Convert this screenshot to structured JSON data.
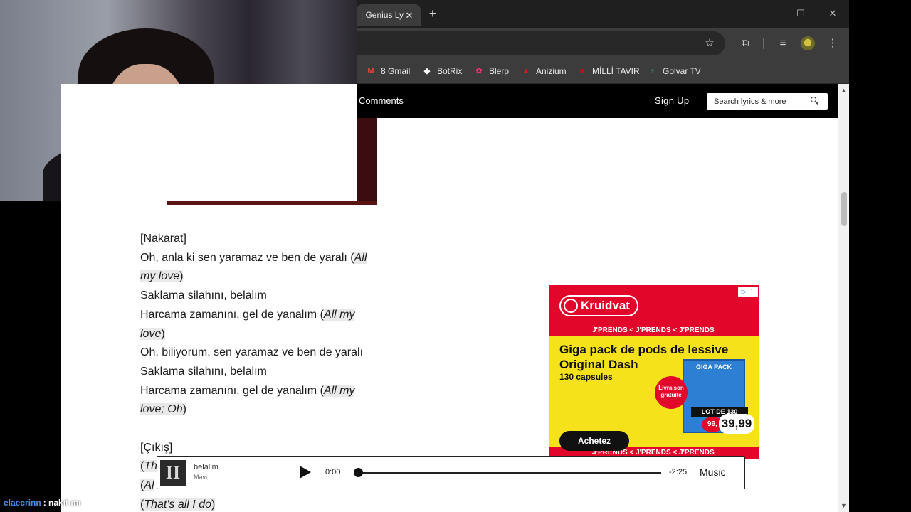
{
  "browser": {
    "tab_title": "| Genius Ly",
    "tab_close": "✕",
    "new_tab": "+",
    "window_minimize": "—",
    "window_maximize": "☐",
    "window_close": "✕",
    "toolbar_icons": [
      "star-icon",
      "extensions-icon",
      "media-controls-icon",
      "profile-avatar-icon",
      "menu-kebab-icon"
    ],
    "bookmarks": [
      {
        "label": "8 Gmail",
        "icon": "gmail-icon",
        "color": "#ea4335"
      },
      {
        "label": "BotRix",
        "icon": "botrix-icon",
        "color": "#ffffff"
      },
      {
        "label": "Blerp",
        "icon": "blerp-icon",
        "color": "#e8356b"
      },
      {
        "label": "Anizium",
        "icon": "anizium-icon",
        "color": "#d42020"
      },
      {
        "label": "MİLLİ TAVIR",
        "icon": "milli-tavir-icon",
        "color": "#b3121b"
      },
      {
        "label": "Golvar TV",
        "icon": "golvar-tv-icon",
        "color": "#2fbf71"
      }
    ]
  },
  "genius": {
    "nav_comments": "Comments",
    "nav_signup": "Sign Up",
    "search_placeholder": "Search lyrics & more"
  },
  "lyrics": {
    "nakarat_header": "[Nakarat]",
    "l1a": "Oh, anla ki sen yaramaz ve ben de yaralı (",
    "l1b": "All",
    "l2a": "my love",
    "l2b": ")",
    "l3": "Saklama silahını, belalım",
    "l4a": "Harcama zamanını, gel de yanalım (",
    "l4b": "All my",
    "l5a": "love",
    "l5b": ")",
    "l6": "Oh, biliyorum, sen yaramaz ve ben de yaralı",
    "l7": "Saklama silahını, belalım",
    "l8a": "Harcama zamanını, gel de yanalım (",
    "l8b": "All my",
    "l9a": "love; Oh",
    "l9b": ")",
    "cikis_header": "[Çıkış]",
    "l10a": "(",
    "l10b": "Th",
    "l11a": "(",
    "l11b": "Al",
    "l12a": "(",
    "l12b": "That's all I do",
    "l12c": ")"
  },
  "ad": {
    "brand": "Kruidvat",
    "choices": "▷ ⋮",
    "stripe": "J'PRENDS < J'PRENDS < J'PRENDS",
    "title_line1": "Giga pack de pods de lessive",
    "title_line2": "Original Dash",
    "subtitle": "130 capsules",
    "badge": "Livraison gratuite",
    "box_label": "GIGA PACK",
    "lot": "LOT DE 130",
    "old_price": "99,",
    "price": "39,99",
    "cta": "Achetez",
    "brand_color": "#e3062b",
    "bg_color": "#f5e21a"
  },
  "player": {
    "album_art": "II",
    "title": "belalim",
    "artist": "Mavi",
    "time_current": "0:00",
    "time_remaining": "-2:25",
    "progress": 0,
    "service": " Music"
  },
  "chat": {
    "username": "elaecrinn",
    "message": ": nakıt mı",
    "username_color": "#4a8fe8"
  }
}
